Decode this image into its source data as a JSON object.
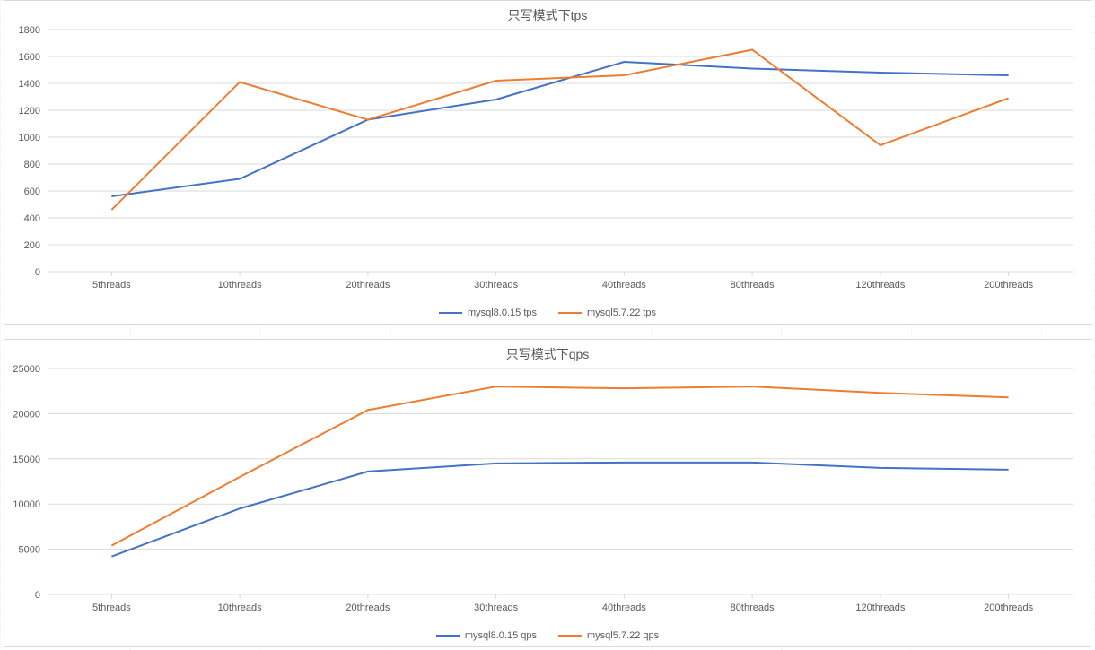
{
  "chart_data": [
    {
      "type": "line",
      "title": "只写模式下tps",
      "xlabel": "",
      "ylabel": "",
      "categories": [
        "5threads",
        "10threads",
        "20threads",
        "30threads",
        "40threads",
        "80threads",
        "120threads",
        "200threads"
      ],
      "series": [
        {
          "name": "mysql8.0.15 tps",
          "color": "#4472c4",
          "values": [
            560,
            690,
            1130,
            1280,
            1560,
            1510,
            1480,
            1460
          ]
        },
        {
          "name": "mysql5.7.22 tps",
          "color": "#ed7d31",
          "values": [
            460,
            1410,
            1130,
            1420,
            1460,
            1650,
            940,
            1290
          ]
        }
      ],
      "ylim": [
        0,
        1800
      ],
      "yticks": [
        0,
        200,
        400,
        600,
        800,
        1000,
        1200,
        1400,
        1600,
        1800
      ],
      "grid": "horizontal",
      "legend_position": "bottom"
    },
    {
      "type": "line",
      "title": "只写模式下qps",
      "xlabel": "",
      "ylabel": "",
      "categories": [
        "5threads",
        "10threads",
        "20threads",
        "30threads",
        "40threads",
        "80threads",
        "120threads",
        "200threads"
      ],
      "series": [
        {
          "name": "mysql8.0.15 qps",
          "color": "#4472c4",
          "values": [
            4200,
            9500,
            13600,
            14500,
            14600,
            14600,
            14000,
            13800
          ]
        },
        {
          "name": "mysql5.7.22 qps",
          "color": "#ed7d31",
          "values": [
            5400,
            13000,
            20400,
            23000,
            22800,
            23000,
            22300,
            21800
          ]
        }
      ],
      "ylim": [
        0,
        25000
      ],
      "yticks": [
        0,
        5000,
        10000,
        15000,
        20000,
        25000
      ],
      "grid": "horizontal",
      "legend_position": "bottom"
    }
  ],
  "colors": {
    "series_blue": "#4472c4",
    "series_orange": "#ed7d31",
    "axis": "#d9d9d9"
  }
}
